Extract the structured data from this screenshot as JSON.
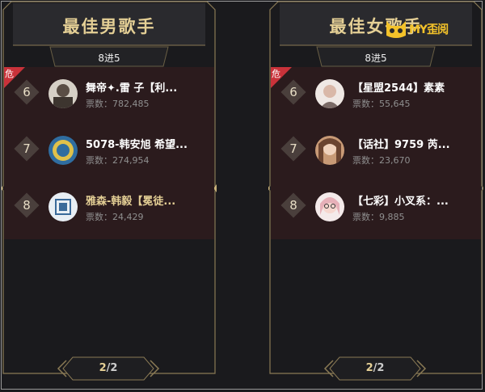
{
  "left_panel": {
    "title": "最佳男歌手",
    "subtitle": "8进5",
    "danger_label": "危",
    "entries": [
      {
        "rank": "6",
        "name": "舞帝✦.雷 子【利...",
        "votes": "票数：782,485",
        "gold": false
      },
      {
        "rank": "7",
        "name": "5078-韩安旭 希望...",
        "votes": "票数：274,954",
        "gold": false
      },
      {
        "rank": "8",
        "name": "雅森-韩毅【冕徒...",
        "votes": "票数：24,429",
        "gold": true
      }
    ],
    "pager": {
      "current": "2",
      "total": "/2"
    }
  },
  "right_panel": {
    "title": "最佳女歌手",
    "subtitle": "8进5",
    "danger_label": "危",
    "entries": [
      {
        "rank": "6",
        "name": "【星盟2544】素素",
        "votes": "票数：55,645",
        "gold": false
      },
      {
        "rank": "7",
        "name": "【话社】9759 芮...",
        "votes": "票数：23,670",
        "gold": false
      },
      {
        "rank": "8",
        "name": "【七彩】小叉系：...",
        "votes": "票数：9,885",
        "gold": false
      }
    ],
    "pager": {
      "current": "2",
      "total": "/2"
    }
  },
  "watermark": {
    "text": "MY歪阅",
    "icon": "cat-face-icon"
  },
  "colors": {
    "gold": "#e4cf95",
    "danger": "#c9323a",
    "list_bg": "#2b1b1d",
    "bg": "#1a1a1d"
  }
}
